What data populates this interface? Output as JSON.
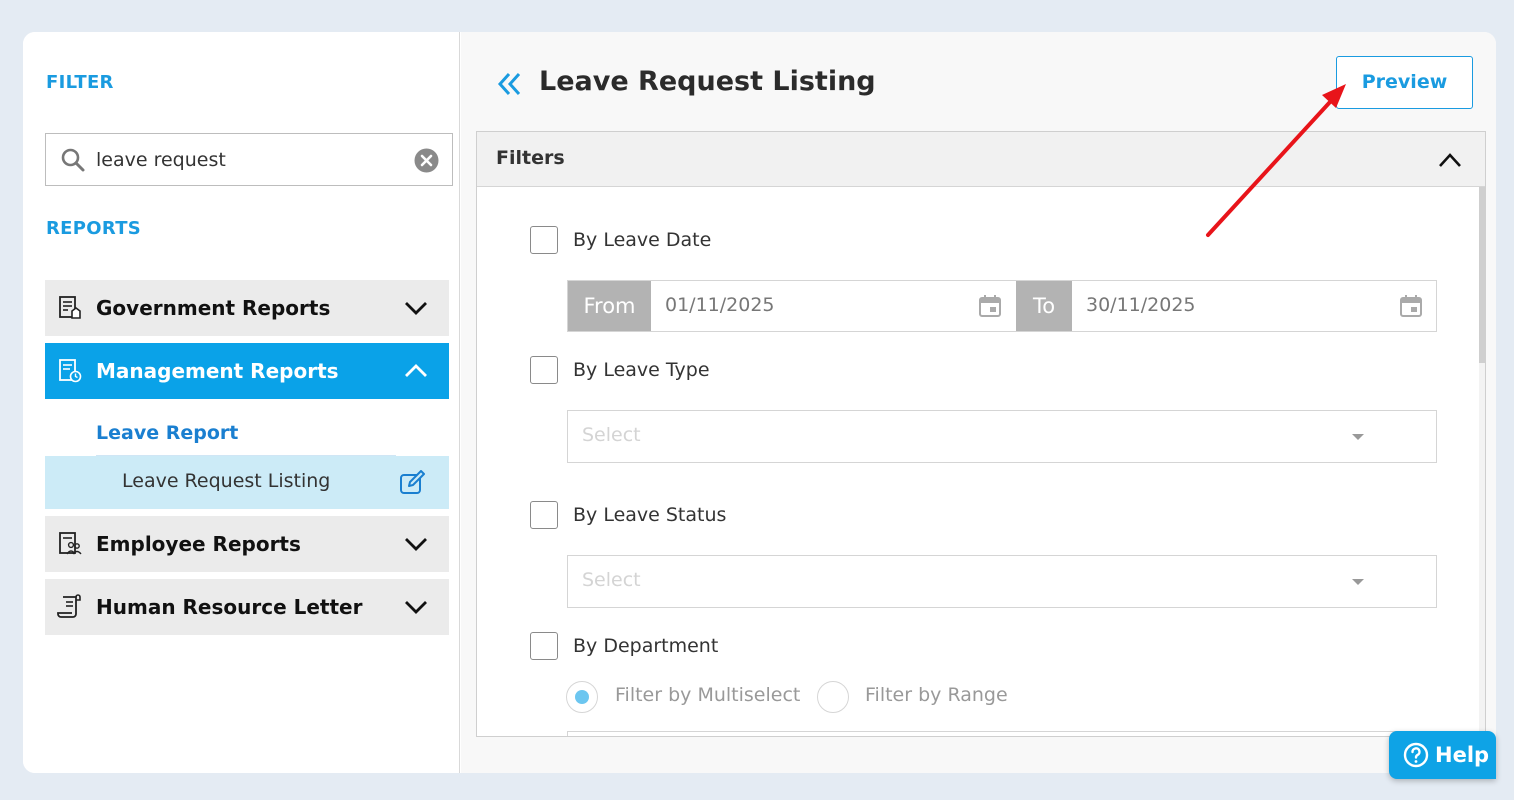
{
  "sidebar": {
    "filter_title": "FILTER",
    "search": {
      "value": "leave request",
      "placeholder": ""
    },
    "reports_title": "REPORTS",
    "categories": [
      {
        "label": "Government Reports",
        "expanded": false
      },
      {
        "label": "Management Reports",
        "expanded": true
      },
      {
        "label": "Employee Reports",
        "expanded": false
      },
      {
        "label": "Human Resource Letter",
        "expanded": false
      }
    ],
    "sub_group": "Leave Report",
    "sub_item": "Leave Request Listing"
  },
  "main": {
    "title": "Leave Request Listing",
    "preview_label": "Preview",
    "filters": {
      "title": "Filters",
      "by_leave_date": "By Leave Date",
      "from_label": "From",
      "from_value": "01/11/2025",
      "to_label": "To",
      "to_value": "30/11/2025",
      "by_leave_type": "By Leave Type",
      "leave_type_placeholder": "Select",
      "by_leave_status": "By Leave Status",
      "leave_status_placeholder": "Select",
      "by_department": "By Department",
      "radio_multiselect": "Filter by Multiselect",
      "radio_range": "Filter by Range"
    }
  },
  "help_label": "Help",
  "colors": {
    "accent": "#0aa2e8",
    "link": "#1a7fd0",
    "annotation_arrow": "#e8141a"
  }
}
